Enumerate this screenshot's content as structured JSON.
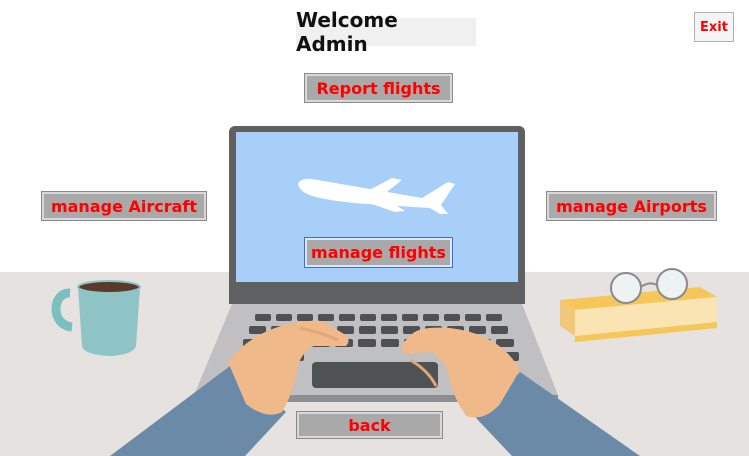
{
  "header": {
    "title": "Welcome Admin"
  },
  "exit_button": {
    "label": "Exit"
  },
  "buttons": {
    "report_flights": "Report flights",
    "manage_aircraft": "manage Aircraft",
    "manage_airports": "manage Airports",
    "manage_flights": "manage flights",
    "back": "back"
  },
  "colors": {
    "button_bg": "#a9a9a9",
    "button_text": "#ff0000",
    "screen": "#a8cff7",
    "desk": "#e5e2df"
  }
}
